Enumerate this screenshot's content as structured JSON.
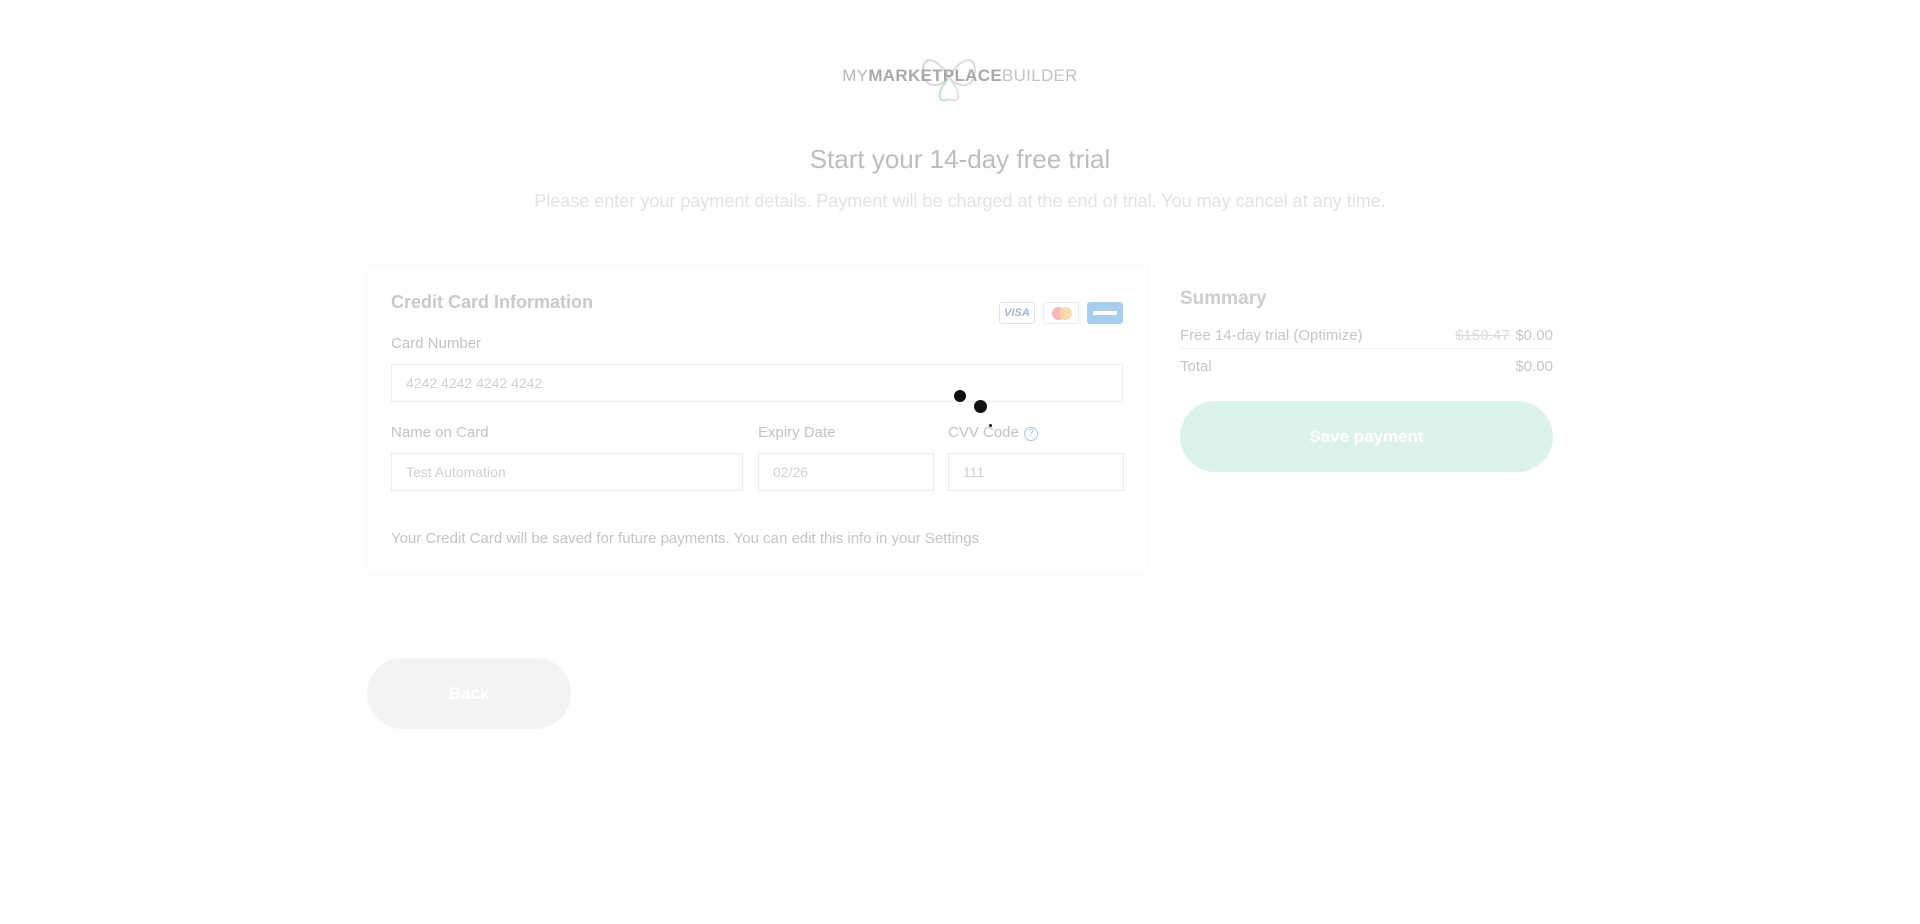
{
  "logo": {
    "part1": "MY",
    "part2": "MARKETPLACE",
    "part3": "BUILDER"
  },
  "header": {
    "title": "Start your 14-day free trial",
    "subtitle": "Please enter your payment details. Payment will be charged at the end of trial. You may cancel at any time."
  },
  "card_form": {
    "title": "Credit Card Information",
    "card_logos": [
      "visa",
      "mastercard",
      "amex"
    ],
    "visa_text": "VISA",
    "card_number_label": "Card Number",
    "card_number_value": "4242 4242 4242 4242",
    "name_label": "Name on Card",
    "name_value": "Test Automation",
    "expiry_label": "Expiry Date",
    "expiry_value": "02/26",
    "cvv_label": "CVV Code",
    "cvv_help": "?",
    "cvv_value": "111",
    "note": "Your Credit Card will be saved for future payments. You can edit this info in your Settings"
  },
  "summary": {
    "title": "Summary",
    "item_label": "Free 14-day trial (Optimize)",
    "item_old_price": "$150.47",
    "item_price": "$0.00",
    "total_label": "Total",
    "total_value": "$0.00",
    "save_label": "Save payment"
  },
  "back_label": "Back",
  "colors": {
    "save_button": "#dbf3e8",
    "help_icon": "#9fc6ee",
    "spinner": "#111111"
  }
}
